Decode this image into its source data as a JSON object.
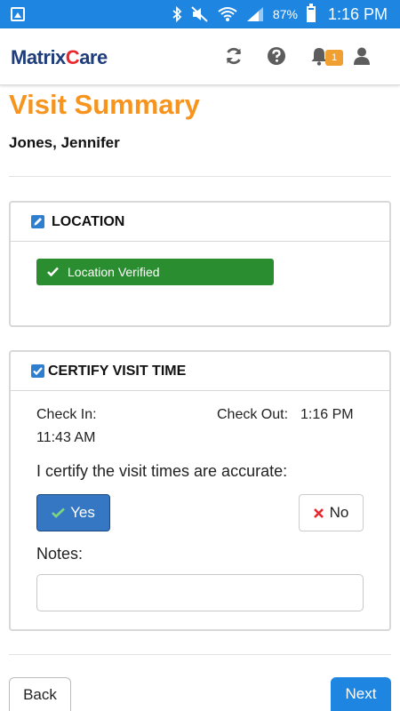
{
  "status_bar": {
    "battery_pct": "87%",
    "time": "1:16 PM",
    "icons": [
      "image-icon",
      "bluetooth-icon",
      "mute-icon",
      "wifi-icon",
      "signal-icon",
      "battery-icon"
    ]
  },
  "header": {
    "logo_matrix": "Matrix",
    "logo_c": "C",
    "logo_are": "are",
    "notification_count": "1",
    "icons": [
      "refresh-icon",
      "help-icon",
      "bell-icon",
      "user-icon"
    ]
  },
  "page": {
    "title": "Visit Summary",
    "patient_name": "Jones, Jennifer"
  },
  "location": {
    "heading": "LOCATION",
    "verified_label": "Location Verified"
  },
  "certify": {
    "heading": "CERTIFY VISIT TIME",
    "check_in_label": "Check In:",
    "check_in_value": "11:43 AM",
    "check_out_label": "Check Out:",
    "check_out_value": "1:16 PM",
    "question": "I certify the visit times are accurate:",
    "yes_label": "Yes",
    "no_label": "No",
    "notes_label": "Notes:",
    "notes_value": "",
    "notes_placeholder": ""
  },
  "footer": {
    "back_label": "Back",
    "next_label": "Next"
  },
  "colors": {
    "status_bar": "#1e86e0",
    "title_orange": "#f7941d",
    "verified_green": "#2a8d2f",
    "yes_blue": "#3577c2",
    "next_blue": "#1e86e0",
    "no_red": "#e8262d"
  }
}
